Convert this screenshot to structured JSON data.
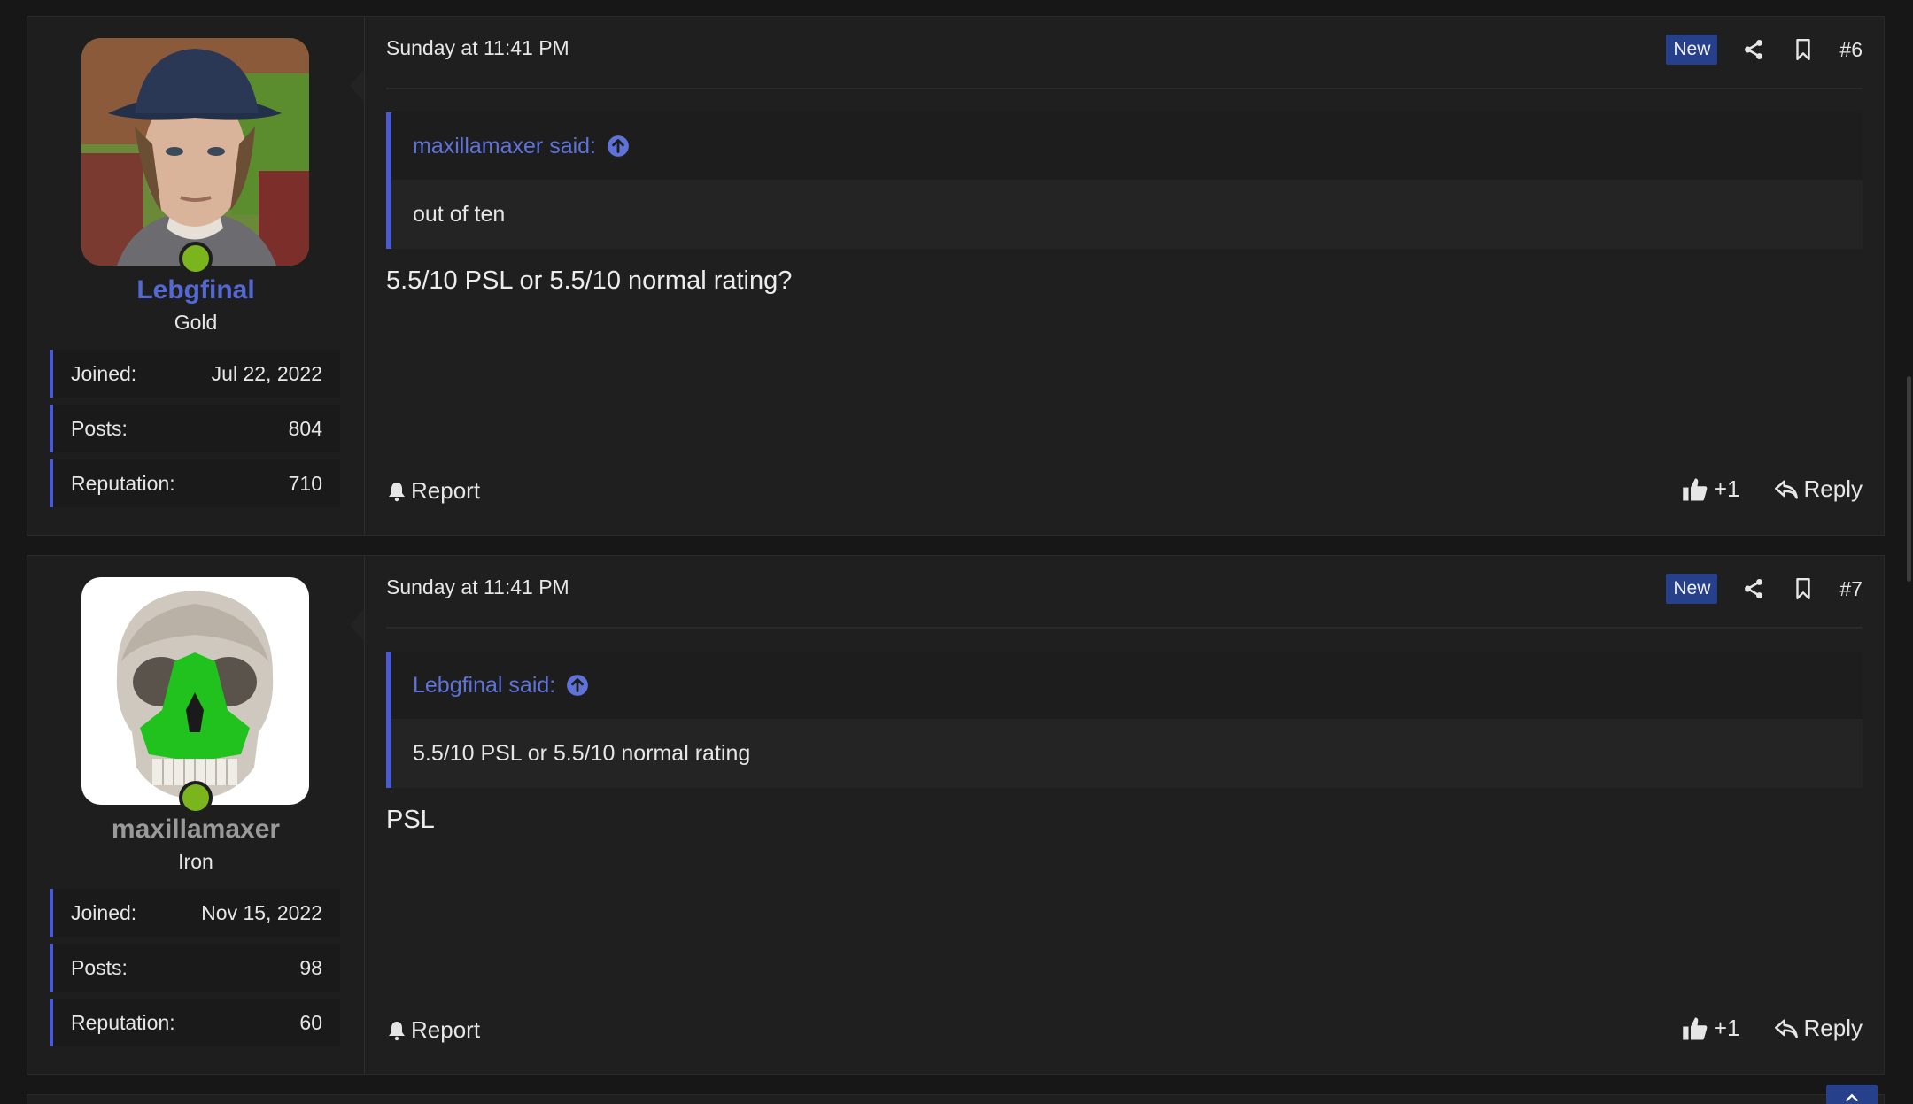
{
  "posts": [
    {
      "user": {
        "name": "Lebgfinal",
        "rank": "Gold",
        "stats": [
          {
            "label": "Joined:",
            "value": "Jul 22, 2022"
          },
          {
            "label": "Posts:",
            "value": "804"
          },
          {
            "label": "Reputation:",
            "value": "710"
          }
        ]
      },
      "date": "Sunday at 11:41 PM",
      "badge": "New",
      "number": "#6",
      "quote": {
        "author": "maxillamaxer said:",
        "text": "out of ten"
      },
      "message": "5.5/10 PSL or 5.5/10 normal rating?",
      "report_label": "Report",
      "reaction_label": "+1",
      "reply_label": "Reply"
    },
    {
      "user": {
        "name": "maxillamaxer",
        "rank": "Iron",
        "stats": [
          {
            "label": "Joined:",
            "value": "Nov 15, 2022"
          },
          {
            "label": "Posts:",
            "value": "98"
          },
          {
            "label": "Reputation:",
            "value": "60"
          }
        ]
      },
      "date": "Sunday at 11:41 PM",
      "badge": "New",
      "number": "#7",
      "quote": {
        "author": "Lebgfinal said:",
        "text": "5.5/10 PSL or 5.5/10 normal rating"
      },
      "message": "PSL",
      "report_label": "Report",
      "reaction_label": "+1",
      "reply_label": "Reply"
    }
  ],
  "colors": {
    "accent": "#4a5ad0",
    "username_gold": "#5468d4",
    "username_iron": "#9a9a9a",
    "online": "#7ab51d",
    "badge_bg": "#27408b",
    "skull_highlight": "#22c21e"
  },
  "icons": [
    "share-icon",
    "bookmark-icon",
    "bell-icon",
    "thumbs-up-icon",
    "reply-arrow-icon",
    "arrow-up-circle-icon",
    "chevron-up-icon"
  ]
}
